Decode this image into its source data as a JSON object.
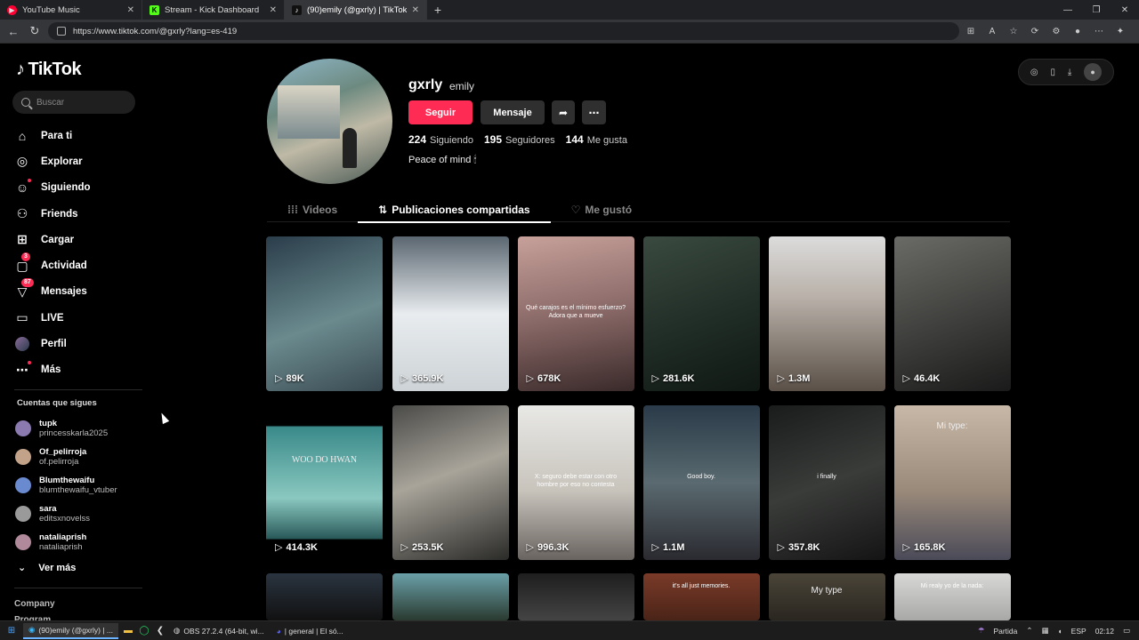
{
  "browser": {
    "tabs": [
      {
        "title": "YouTube Music",
        "favicon_color": "#ff0033"
      },
      {
        "title": "Stream - Kick Dashboard",
        "favicon_color": "#53fc18"
      },
      {
        "title": "(90)emily (@gxrly) | TikTok",
        "favicon_color": "#111111"
      }
    ],
    "url": "https://www.tiktok.com/@gxrly?lang=es-419"
  },
  "sidebar": {
    "logo": "TikTok",
    "search_placeholder": "Buscar",
    "nav": [
      {
        "label": "Para ti",
        "icon": "home-icon"
      },
      {
        "label": "Explorar",
        "icon": "compass-icon"
      },
      {
        "label": "Siguiendo",
        "icon": "following-icon"
      },
      {
        "label": "Friends",
        "icon": "friends-icon"
      },
      {
        "label": "Cargar",
        "icon": "upload-icon"
      },
      {
        "label": "Actividad",
        "icon": "activity-icon",
        "badge": "3"
      },
      {
        "label": "Mensajes",
        "icon": "messages-icon",
        "badge": "87"
      },
      {
        "label": "LIVE",
        "icon": "live-icon"
      },
      {
        "label": "Perfil",
        "icon": "profile-avatar"
      },
      {
        "label": "Más",
        "icon": "more-icon"
      }
    ],
    "following_title": "Cuentas que sigues",
    "following": [
      {
        "username": "tupk",
        "name": "princesskarla2025",
        "color": "#8a7ab0"
      },
      {
        "username": "Of_pelirroja",
        "name": "of.pelirroja",
        "color": "#c2a38a"
      },
      {
        "username": "Blumthewaifu",
        "name": "blumthewaifu_vtuber",
        "color": "#6a8ad0"
      },
      {
        "username": "sara",
        "name": "editsxnovelss",
        "color": "#9a9a9a"
      },
      {
        "username": "nataliaprish",
        "name": "nataliaprish",
        "color": "#b08a9a"
      }
    ],
    "see_more": "Ver más",
    "company": "Company",
    "program": "Program"
  },
  "profile": {
    "username": "gxrly",
    "nickname": "emily",
    "follow_label": "Seguir",
    "message_label": "Mensaje",
    "following_count": "224",
    "following_label": "Siguiendo",
    "followers_count": "195",
    "followers_label": "Seguidores",
    "likes_count": "144",
    "likes_label": "Me gusta",
    "bio": "Peace of mind 🕯"
  },
  "tabs": [
    "Videos",
    "Publicaciones compartidas",
    "Me gustó"
  ],
  "videos": [
    {
      "views": "89K",
      "bg": "linear-gradient(160deg,#2a3d4a,#6a8a8e 55%,#3a4a52)"
    },
    {
      "views": "365.9K",
      "bg": "linear-gradient(180deg,#5a6670,#e8ecef 50%,#cdd3d6)"
    },
    {
      "views": "678K",
      "bg": "linear-gradient(170deg,#c7a09a,#8a6a68 50%,#3a2a2a)",
      "caption": "Qué carajos es el mínimo esfuerzo? Adora que a mueve"
    },
    {
      "views": "281.6K",
      "bg": "linear-gradient(160deg,#3a4a40,#1e2a24 60%,#101813)"
    },
    {
      "views": "1.3M",
      "bg": "linear-gradient(180deg,#dcdcdc,#b8b0a8 40%,#5a5048)"
    },
    {
      "views": "46.4K",
      "bg": "linear-gradient(160deg,#6a6a66,#3a3a38 60%,#1a1a1a)"
    },
    {
      "views": "414.3K",
      "bg": "linear-gradient(180deg,#000 0%,#000 13%,#3a8a8a 14%,#8ac8c0 60%,#2a5a5a 86%,#000 87%)",
      "caption_big": "WOO DO HWAN"
    },
    {
      "views": "253.5K",
      "bg": "linear-gradient(160deg,#4a4a48,#a8a49a 45%,#2a2a28)"
    },
    {
      "views": "996.3K",
      "bg": "linear-gradient(180deg,#e8e8e6,#c8c4bc 55%,#6a6460)",
      "caption": "X: seguro debe estar con otro hombre por eso no contesta"
    },
    {
      "views": "1.1M",
      "bg": "linear-gradient(180deg,#2a3a48,#5a6a70 50%,#2a2a30)",
      "caption": "Good boy."
    },
    {
      "views": "357.8K",
      "bg": "linear-gradient(160deg,#1a1c1c,#3a3c3a 50%,#141414)",
      "caption": "i finally"
    },
    {
      "views": "165.8K",
      "bg": "linear-gradient(180deg,#c8b8a8,#9a8a7a 55%,#4a4a58)",
      "caption_big": "Mi type:"
    },
    {
      "views": "",
      "bg": "linear-gradient(180deg,#2a3440,#111)"
    },
    {
      "views": "",
      "bg": "linear-gradient(180deg,#6aa0a8,#2a3a30)"
    },
    {
      "views": "",
      "bg": "linear-gradient(180deg,#1e1e1e,#444)"
    },
    {
      "views": "",
      "bg": "linear-gradient(180deg,#7a3a28,#4a2418)",
      "caption": "it's all just memories."
    },
    {
      "views": "",
      "bg": "linear-gradient(180deg,#4a4438,#2a2620)",
      "caption_big": "My type"
    },
    {
      "views": "",
      "bg": "linear-gradient(180deg,#d8d8d6,#a8a8a6)",
      "caption": "Mi realy yo de la nada:"
    }
  ],
  "taskbar": {
    "items": [
      "(90)emily (@gxrly) | ...",
      "OBS 27.2.4 (64-bit, wi...",
      "| general | El só..."
    ],
    "weather": "Partida",
    "lang": "ESP",
    "time": "02:12"
  }
}
